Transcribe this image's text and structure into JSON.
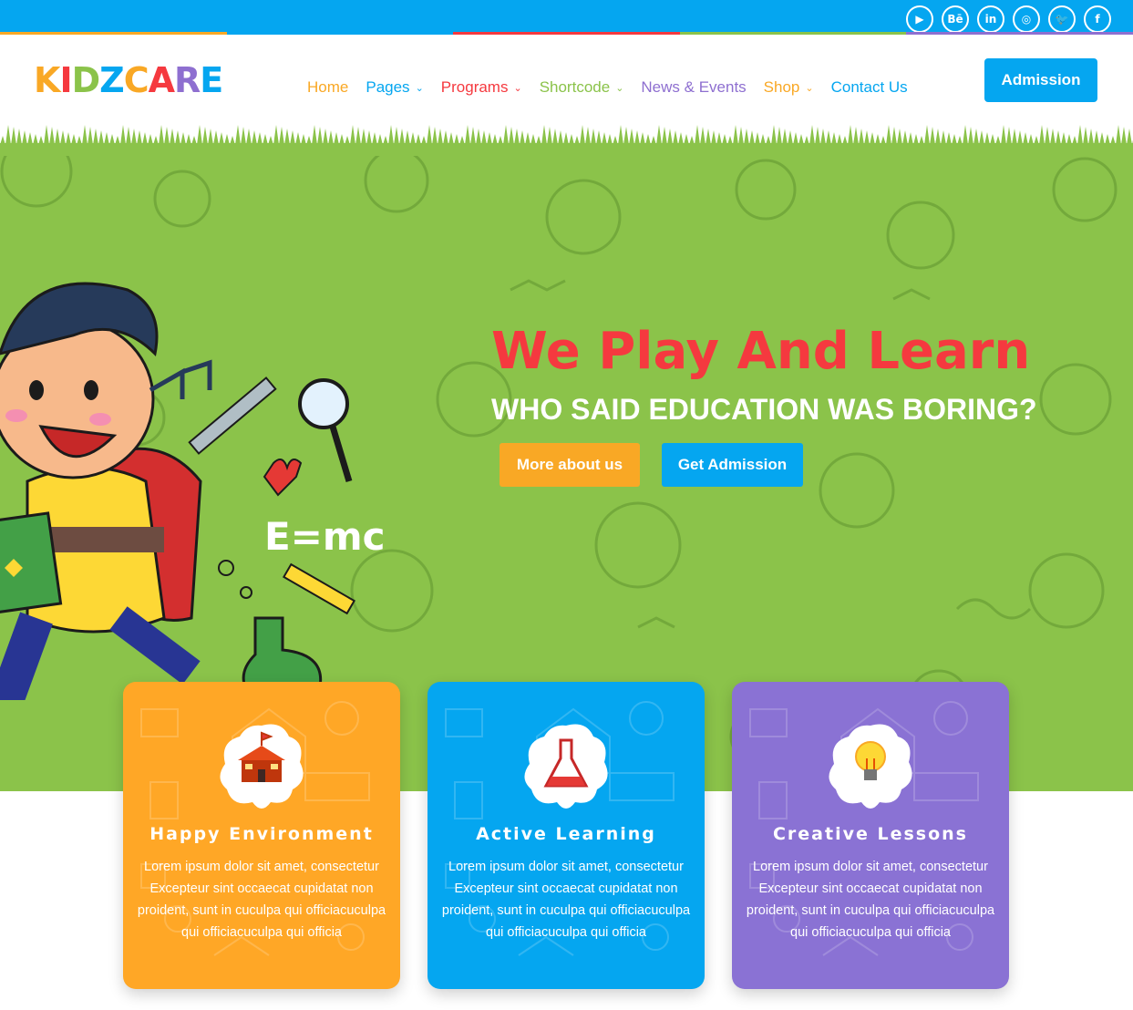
{
  "topbar": {
    "stripe_colors": [
      "#f9a825",
      "#05a6f0",
      "#f5393f",
      "#8bc34a",
      "#8e6fd0"
    ],
    "social": [
      {
        "icon": "youtube-icon",
        "glyph": "▶"
      },
      {
        "icon": "behance-icon",
        "glyph": "Bē"
      },
      {
        "icon": "linkedin-icon",
        "glyph": "in"
      },
      {
        "icon": "instagram-icon",
        "glyph": "◎"
      },
      {
        "icon": "twitter-icon",
        "glyph": "🐦"
      },
      {
        "icon": "facebook-icon",
        "glyph": "f"
      }
    ]
  },
  "header": {
    "logo_letters": [
      {
        "ch": "K",
        "color": "#f9a825"
      },
      {
        "ch": "I",
        "color": "#f5393f"
      },
      {
        "ch": "D",
        "color": "#8bc34a"
      },
      {
        "ch": "Z",
        "color": "#05a6f0"
      },
      {
        "ch": "C",
        "color": "#f9a825"
      },
      {
        "ch": "A",
        "color": "#f5393f"
      },
      {
        "ch": "R",
        "color": "#8e6fd0"
      },
      {
        "ch": "E",
        "color": "#05a6f0"
      }
    ],
    "nav": [
      {
        "label": "Home",
        "color": "#f9a825",
        "dropdown": false
      },
      {
        "label": "Pages",
        "color": "#05a6f0",
        "dropdown": true
      },
      {
        "label": "Programs",
        "color": "#f5393f",
        "dropdown": true
      },
      {
        "label": "Shortcode",
        "color": "#8bc34a",
        "dropdown": true
      },
      {
        "label": "News & Events",
        "color": "#8e6fd0",
        "dropdown": false
      },
      {
        "label": "Shop",
        "color": "#f9a825",
        "dropdown": true
      },
      {
        "label": "Contact Us",
        "color": "#05a6f0",
        "dropdown": false
      }
    ],
    "admission_label": "Admission"
  },
  "hero": {
    "title": "We Play And Learn",
    "subtitle": "WHO SAID EDUCATION WAS BORING?",
    "more_label": "More about us",
    "admission_label": "Get Admission",
    "bg_color": "#8bc34a"
  },
  "cards": [
    {
      "title": "Happy Environment",
      "text": "Lorem ipsum dolor sit amet, consectetur Excepteur sint occaecat cupidatat non proident, sunt in cuculpa qui officiacuculpa qui officiacuculpa qui officia",
      "color": "#ffa726",
      "icon": "school-icon"
    },
    {
      "title": "Active Learning",
      "text": "Lorem ipsum dolor sit amet, consectetur Excepteur sint occaecat cupidatat non proident, sunt in cuculpa qui officiacuculpa qui officiacuculpa qui officia",
      "color": "#05a6f0",
      "icon": "flask-icon"
    },
    {
      "title": "Creative Lessons",
      "text": "Lorem ipsum dolor sit amet, consectetur Excepteur sint occaecat cupidatat non proident, sunt in cuculpa qui officiacuculpa qui officiacuculpa qui officia",
      "color": "#8a72d4",
      "icon": "lightbulb-icon"
    }
  ]
}
